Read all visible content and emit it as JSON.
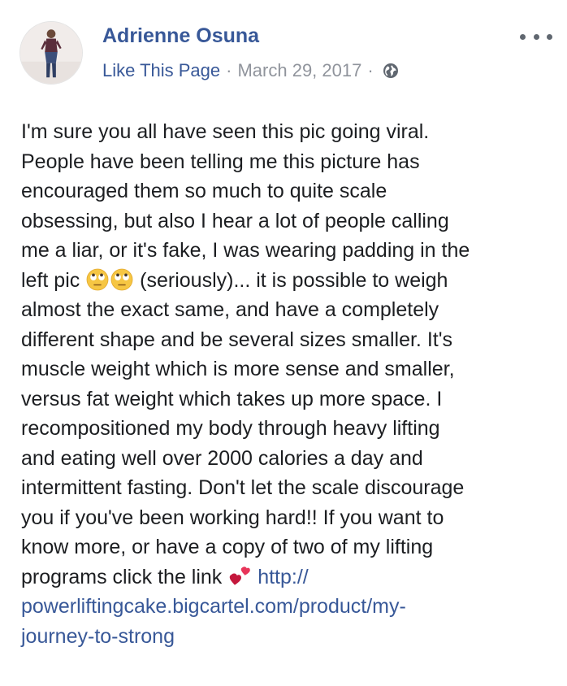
{
  "post": {
    "author_name": "Adrienne Osuna",
    "like_page_label": "Like This Page",
    "separator": "·",
    "date": "March 29, 2017",
    "privacy_icon": "globe-icon",
    "more_icon": "ellipsis-icon",
    "body": {
      "text_1": "I'm sure you all have seen this pic going viral.\nPeople have been telling me this picture has\nencouraged them so much to quite scale\nobsessing, but also I hear a lot of people calling\nme a liar, or it's fake, I was wearing padding in the\nleft pic ",
      "emoji_1": "eye-roll-emoji",
      "emoji_2": "eye-roll-emoji",
      "text_2": " (seriously)... it is possible to weigh\nalmost the exact same, and have a completely\ndifferent shape and be several sizes smaller. It's\nmuscle weight which is more sense and smaller,\nversus fat weight which takes up more space. I\nrecompositioned my body through heavy lifting\nand eating well over 2000 calories a day and\nintermittent fasting. Don't let the scale discourage\nyou if you've been working hard!! If you want to\nknow more, or have a copy of two of my lifting\nprograms click the link ",
      "emoji_3": "two-hearts-emoji",
      "text_3": " ",
      "link_text": "http://\npowerliftingcake.bigcartel.com/product/my-\njourney-to-strong"
    }
  },
  "colors": {
    "link_blue": "#385898",
    "meta_gray": "#90949c",
    "text": "#1c1e21"
  }
}
